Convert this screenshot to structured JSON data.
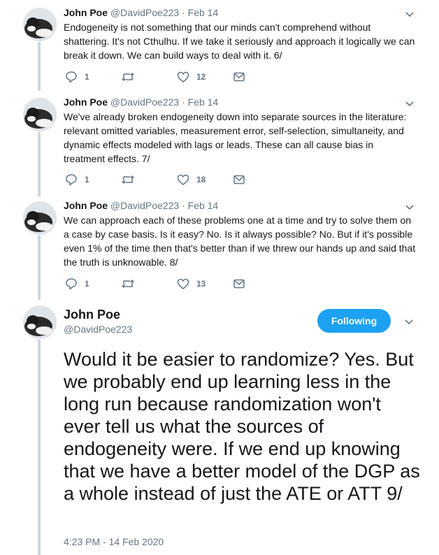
{
  "tweets": [
    {
      "name": "John Poe",
      "handle": "@DavidPoe223",
      "separator": "·",
      "date": "Feb 14",
      "text": "Endogeneity is not something that our minds can't comprehend without shattering. It's not Cthulhu. If we take it seriously and approach it logically we can break it down. We can build ways to deal with it. 6/",
      "replies": "1",
      "retweets": "",
      "likes": "12"
    },
    {
      "name": "John Poe",
      "handle": "@DavidPoe223",
      "separator": "·",
      "date": "Feb 14",
      "text": "We've already broken endogeneity down into separate sources in the literature: relevant omitted variables, measurement error, self-selection, simultaneity, and dynamic effects modeled with lags or leads. These can all cause bias in treatment effects.  7/",
      "replies": "1",
      "retweets": "",
      "likes": "18"
    },
    {
      "name": "John Poe",
      "handle": "@DavidPoe223",
      "separator": "·",
      "date": "Feb 14",
      "text": "We can approach each of these problems one at a time and try to solve them on a case by case basis. Is it easy? No. Is it always possible? No. But if it's possible even 1% of the time then that's better than if we threw our hands up and said that the truth is unknowable. 8/",
      "replies": "1",
      "retweets": "",
      "likes": "13"
    }
  ],
  "main_tweet": {
    "name": "John Poe",
    "handle": "@DavidPoe223",
    "follow_label": "Following",
    "text": "Would it be easier to randomize? Yes. But we probably end up learning less in the long run because randomization won't ever tell us what the sources of endogeneity were. If we end up knowing that we have a better model of the DGP as a whole instead of just the ATE or ATT 9/",
    "timestamp": "4:23 PM - 14 Feb 2020"
  },
  "icons": [
    "reply-icon",
    "retweet-icon",
    "like-icon",
    "message-icon",
    "chevron-down-icon",
    "avatar"
  ],
  "colors": {
    "accent": "#1da1f2",
    "muted": "#657786",
    "thread_line": "#ccd6dd",
    "text": "#14171a"
  }
}
